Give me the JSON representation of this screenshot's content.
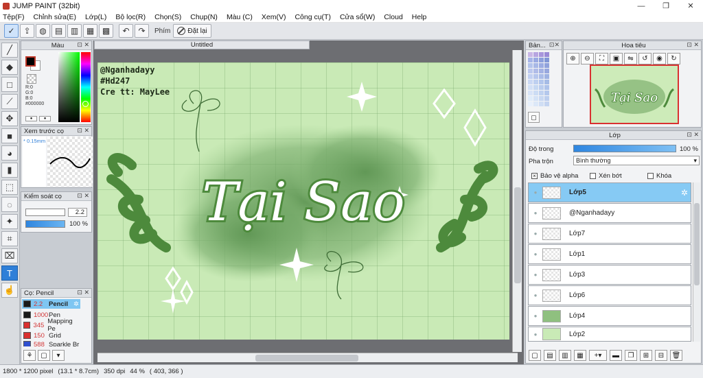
{
  "window": {
    "title": "JUMP PAINT (32bit)",
    "minimize": "—",
    "restore": "❐",
    "close": "✕"
  },
  "menu": [
    "Tệp(F)",
    "Chỉnh sửa(E)",
    "Lớp(L)",
    "Bộ lọc(R)",
    "Chọn(S)",
    "Chụp(N)",
    "Màu (C)",
    "Xem(V)",
    "Công cụ(T)",
    "Cửa sổ(W)",
    "Cloud",
    "Help"
  ],
  "toolbar": {
    "phim_label": "Phím",
    "reset_label": "Đặt lại"
  },
  "color_panel": {
    "title": "Màu",
    "r": "R:0",
    "g": "G:0",
    "b": "B:0",
    "hex": "#000000",
    "fg": "#000000",
    "bg": "#ffffff"
  },
  "preview_panel": {
    "title": "Xem trước cọ",
    "size": "0.15mm"
  },
  "brush_control": {
    "title": "Kiểm soát cọ",
    "size": "2.2",
    "opacity": "100 %"
  },
  "brush_panel": {
    "title": "Cọ: Pencil",
    "items": [
      {
        "num": "2.2",
        "name": "Pencil",
        "color": "#1a1a1a"
      },
      {
        "num": "1000",
        "name": "Pen",
        "color": "#1a1a1a"
      },
      {
        "num": "345",
        "name": "Mapping Pe",
        "color": "#d93030"
      },
      {
        "num": "150",
        "name": "Grid",
        "color": "#d93030"
      },
      {
        "num": "588",
        "name": "Sparkle Br",
        "color": "#3050d0"
      }
    ]
  },
  "canvas": {
    "tab": "Untitled",
    "credits": [
      "@Nganhadayy",
      "#Hd247",
      "Cre tt: MayLee"
    ],
    "artwork_title": "Tại Sao"
  },
  "palette_panel": {
    "title": "Bản..."
  },
  "navigator_panel": {
    "title": "Hoa tiêu"
  },
  "layer_panel": {
    "title": "Lớp",
    "opacity_label": "Độ trong",
    "opacity_value": "100 %",
    "blend_label": "Pha trộn",
    "blend_value": "Bình thường",
    "protect_alpha": "Bảo vệ alpha",
    "clip": "Xén bớt",
    "lock": "Khóa",
    "layers": [
      {
        "name": "Lớp5",
        "active": true
      },
      {
        "name": "@Nganhadayy",
        "active": false
      },
      {
        "name": "Lớp7",
        "active": false
      },
      {
        "name": "Lớp1",
        "active": false
      },
      {
        "name": "Lớp3",
        "active": false
      },
      {
        "name": "Lớp6",
        "active": false
      },
      {
        "name": "Lớp4",
        "active": false
      },
      {
        "name": "Lớp2",
        "active": false
      }
    ]
  },
  "status": {
    "size": "1800 * 1200 pixel",
    "physical": "(13.1 * 8.7cm)",
    "dpi": "350 dpi",
    "zoom": "44 %",
    "coords": "( 403, 366 )"
  }
}
